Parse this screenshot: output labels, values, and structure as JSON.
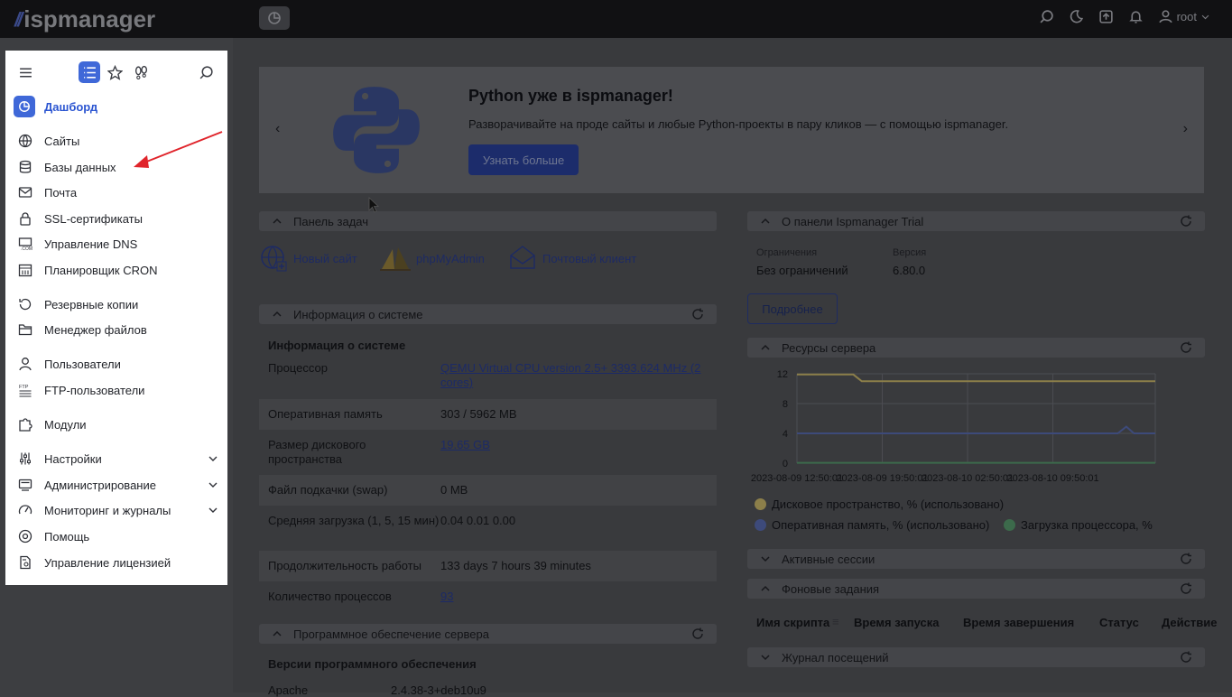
{
  "app": {
    "logo_text": "ispmanager",
    "user": "root"
  },
  "banner": {
    "title": "Python уже в ispmanager!",
    "subtitle": "Разворачивайте на проде сайты и любые Python-проекты в пару кликов — с помощью ispmanager.",
    "button": "Узнать больше",
    "prev_icon": "chevron-left-icon",
    "next_icon": "chevron-right-icon"
  },
  "taskbar": {
    "title": "Панель задач",
    "links": [
      "Новый сайт",
      "phpMyAdmin",
      "Почтовый клиент"
    ]
  },
  "sysinfo": {
    "panel_title": "Информация о системе",
    "heading": "Информация о системе",
    "rows": [
      {
        "label": "Процессор",
        "value": "QEMU Virtual CPU version 2.5+ 3393.624 MHz (2 cores)",
        "link": true
      },
      {
        "label": "Оперативная память",
        "value": "303 / 5962 MB",
        "link": false
      },
      {
        "label": "Размер дискового пространства",
        "value": "19.65 GB",
        "link": true
      },
      {
        "label": "Файл подкачки (swap)",
        "value": "0 MB",
        "link": false
      },
      {
        "label": "Средняя загрузка (1, 5, 15 мин)",
        "value": "0.04 0.01 0.00",
        "link": false
      },
      {
        "label": "Продолжительность работы",
        "value": "133 days 7 hours 39 minutes",
        "link": false
      },
      {
        "label": "Количество процессов",
        "value": "93",
        "link": true
      }
    ]
  },
  "software": {
    "panel_title": "Программное обеспечение сервера",
    "heading": "Версии программного обеспечения",
    "first_row_label": "Apache",
    "first_row_value": "2.4.38-3+deb10u9"
  },
  "about": {
    "panel_title": "О панели Ispmanager Trial",
    "limits_label": "Ограничения",
    "limits_value": "Без ограничений",
    "version_label": "Версия",
    "version_value": "6.80.0",
    "button": "Подробнее"
  },
  "resources": {
    "panel_title": "Ресурсы сервера"
  },
  "sessions": {
    "panel_title": "Активные сессии"
  },
  "bgtasks": {
    "panel_title": "Фоновые задания",
    "columns": [
      "Имя скрипта",
      "Время запуска",
      "Время завершения",
      "Статус",
      "Действие"
    ]
  },
  "visits": {
    "panel_title": "Журнал посещений"
  },
  "chart_data": {
    "type": "line",
    "title": "",
    "x": [
      "2023-08-09 12:50:01",
      "2023-08-09 19:50:01",
      "2023-08-10 02:50:01",
      "2023-08-10 09:50:01"
    ],
    "yticks": [
      "12",
      "8",
      "4",
      "0"
    ],
    "ylim": [
      0,
      12
    ],
    "grid": true,
    "legend_position": "bottom",
    "series": [
      {
        "name": "Дисковое пространство, % (использовано)",
        "color": "#8c7f4a",
        "points": [
          [
            0,
            11.9
          ],
          [
            0.66,
            11.9
          ],
          [
            0.76,
            11.0
          ],
          [
            4.2,
            11.0
          ]
        ]
      },
      {
        "name": "Оперативная память, % (использовано)",
        "color": "#3d4a7a",
        "points": [
          [
            0,
            4.0
          ],
          [
            3.76,
            4.0
          ],
          [
            3.86,
            4.9
          ],
          [
            3.95,
            4.0
          ],
          [
            4.2,
            4.0
          ]
        ]
      },
      {
        "name": "Загрузка процессора, %",
        "color": "#3c6a4b",
        "points": [
          [
            0,
            0.05
          ],
          [
            4.2,
            0.05
          ]
        ]
      }
    ]
  },
  "sidebar": {
    "dashboard": "Дашборд",
    "items": [
      {
        "label": "Сайты",
        "icon": "globe-icon"
      },
      {
        "label": "Базы данных",
        "icon": "database-icon"
      },
      {
        "label": "Почта",
        "icon": "mail-icon"
      },
      {
        "label": "SSL-сертификаты",
        "icon": "lock-icon"
      },
      {
        "label": "Управление DNS",
        "icon": "dns-icon"
      },
      {
        "label": "Планировщик CRON",
        "icon": "calendar-icon"
      },
      {
        "label": "Резервные копии",
        "icon": "backup-icon"
      },
      {
        "label": "Менеджер файлов",
        "icon": "folder-icon"
      },
      {
        "label": "Пользователи",
        "icon": "user-icon"
      },
      {
        "label": "FTP-пользователи",
        "icon": "ftp-icon"
      },
      {
        "label": "Модули",
        "icon": "puzzle-icon"
      },
      {
        "label": "Настройки",
        "icon": "sliders-icon"
      },
      {
        "label": "Администрирование",
        "icon": "server-icon"
      },
      {
        "label": "Мониторинг и журналы",
        "icon": "gauge-icon"
      },
      {
        "label": "Помощь",
        "icon": "help-icon"
      },
      {
        "label": "Управление лицензией",
        "icon": "license-icon"
      }
    ]
  }
}
